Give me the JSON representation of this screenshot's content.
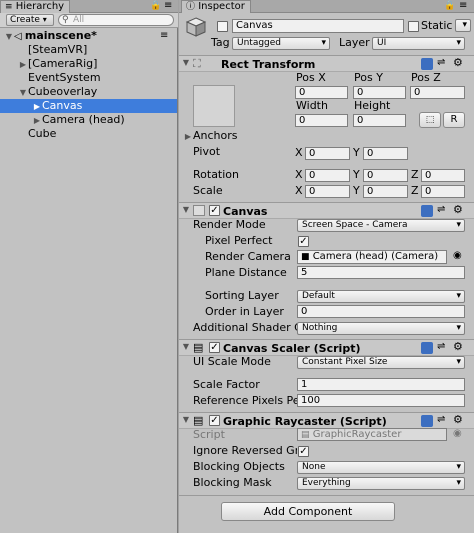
{
  "hierarchy": {
    "tab_label": "Hierarchy",
    "create_label": "Create",
    "search_placeholder": "All",
    "items": [
      {
        "label": "mainscene*",
        "depth": 0,
        "arrow": "▼",
        "selected": false,
        "bold": true
      },
      {
        "label": "[SteamVR]",
        "depth": 1,
        "arrow": "",
        "selected": false,
        "bold": false
      },
      {
        "label": "[CameraRig]",
        "depth": 1,
        "arrow": "▶",
        "selected": false,
        "bold": false
      },
      {
        "label": "EventSystem",
        "depth": 1,
        "arrow": "",
        "selected": false,
        "bold": false
      },
      {
        "label": "Cubeoverlay",
        "depth": 1,
        "arrow": "▼",
        "selected": false,
        "bold": false
      },
      {
        "label": "Canvas",
        "depth": 2,
        "arrow": "▶",
        "selected": true,
        "bold": false
      },
      {
        "label": "Camera (head)",
        "depth": 2,
        "arrow": "▶",
        "selected": false,
        "bold": false
      },
      {
        "label": "Cube",
        "depth": 1,
        "arrow": "",
        "selected": false,
        "bold": false
      }
    ]
  },
  "inspector": {
    "tab_label": "Inspector",
    "object": {
      "name": "Canvas",
      "static_label": "Static",
      "tag_label": "Tag",
      "tag_value": "Untagged",
      "layer_label": "Layer",
      "layer_value": "UI"
    },
    "rect_transform": {
      "title": "Rect Transform",
      "posx_label": "Pos X",
      "posx": "0",
      "posy_label": "Pos Y",
      "posy": "0",
      "posz_label": "Pos Z",
      "posz": "0",
      "width_label": "Width",
      "width": "0",
      "height_label": "Height",
      "height": "0",
      "r_button": "R",
      "anchors_label": "Anchors",
      "pivot_label": "Pivot",
      "pivot_x": "0",
      "pivot_y": "0",
      "rotation_label": "Rotation",
      "rot_x": "0",
      "rot_y": "0",
      "rot_z": "0",
      "scale_label": "Scale",
      "scale_x": "0",
      "scale_y": "0",
      "scale_z": "0",
      "x": "X",
      "y": "Y",
      "z": "Z"
    },
    "canvas": {
      "title": "Canvas",
      "render_mode_label": "Render Mode",
      "render_mode": "Screen Space - Camera",
      "pixel_perfect_label": "Pixel Perfect",
      "render_camera_label": "Render Camera",
      "render_camera": "Camera (head) (Camera)",
      "plane_distance_label": "Plane Distance",
      "plane_distance": "5",
      "sorting_layer_label": "Sorting Layer",
      "sorting_layer": "Default",
      "order_in_layer_label": "Order in Layer",
      "order_in_layer": "0",
      "shader_label": "Additional Shader Ch",
      "shader": "Nothing"
    },
    "canvas_scaler": {
      "title": "Canvas Scaler (Script)",
      "ui_scale_label": "UI Scale Mode",
      "ui_scale": "Constant Pixel Size",
      "scale_factor_label": "Scale Factor",
      "scale_factor": "1",
      "ref_ppu_label": "Reference Pixels Per",
      "ref_ppu": "100"
    },
    "raycaster": {
      "title": "Graphic Raycaster (Script)",
      "script_label": "Script",
      "script": "GraphicRaycaster",
      "ignore_label": "Ignore Reversed Gra",
      "blocking_objects_label": "Blocking Objects",
      "blocking_objects": "None",
      "blocking_mask_label": "Blocking Mask",
      "blocking_mask": "Everything"
    },
    "add_component": "Add Component"
  },
  "colors": {
    "selection": "#3e7ddc",
    "panel": "#c2c2c2"
  }
}
